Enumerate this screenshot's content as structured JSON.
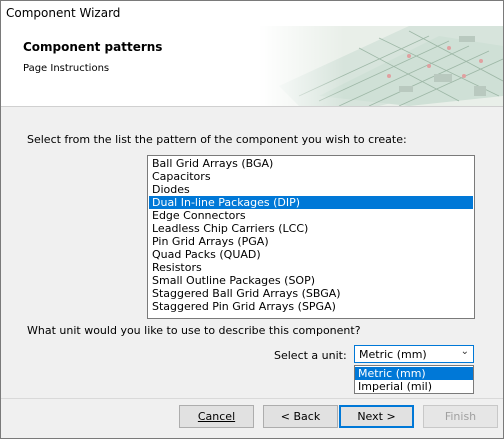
{
  "window": {
    "title": "Component Wizard"
  },
  "header": {
    "title": "Component patterns",
    "subtitle": "Page Instructions"
  },
  "prompt": "Select from the list the pattern of the component you wish to create:",
  "patterns": {
    "items": [
      "Ball Grid Arrays (BGA)",
      "Capacitors",
      "Diodes",
      "Dual In-line Packages (DIP)",
      "Edge Connectors",
      "Leadless Chip Carriers (LCC)",
      "Pin Grid Arrays (PGA)",
      "Quad Packs (QUAD)",
      "Resistors",
      "Small Outline Packages (SOP)",
      "Staggered Ball Grid Arrays (SBGA)",
      "Staggered Pin Grid Arrays (SPGA)"
    ],
    "selected": "Dual In-line Packages (DIP)"
  },
  "unit": {
    "question": "What unit would you like to use to describe this component?",
    "label": "Select a unit:",
    "value": "Metric (mm)",
    "options": [
      "Metric (mm)",
      "Imperial (mil)"
    ]
  },
  "buttons": {
    "cancel": "Cancel",
    "back": "< Back",
    "next": "Next >",
    "finish": "Finish"
  },
  "colors": {
    "selection": "#0078d7",
    "accent_border": "#0078d7"
  }
}
